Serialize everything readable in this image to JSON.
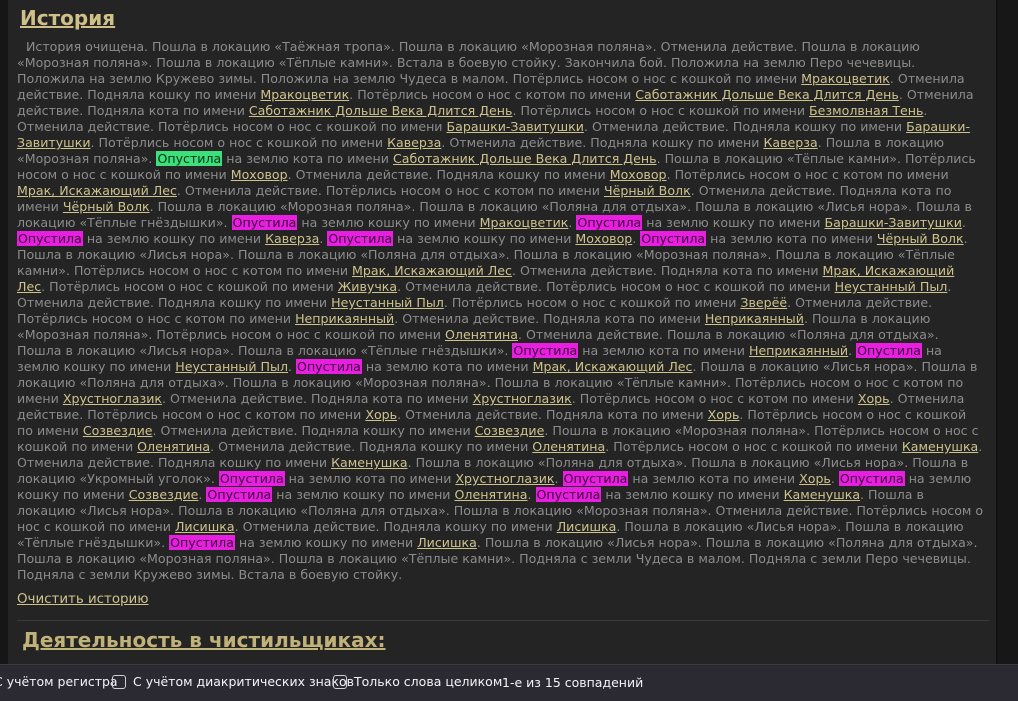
{
  "section_title": "История",
  "history_intro": "История очищена. Пошла в локацию «Таёжная тропа». Пошла в локацию «Морозная поляна». Отменила действие. Пошла в локацию «Морозная поляна». Пошла в локацию «Тёплые камни». Встала в боевую стойку. Закончила бой. Положила на землю Перо чечевицы. Положила на землю Кружево зимы. Положила на землю Чудеса в малом. Потёрлись носом о нос с кошкой по имени ",
  "history": [
    {
      "t": "text",
      "v": "История очищена. Пошла в локацию «Таёжная тропа». Пошла в локацию «Морозная поляна». Отменила действие. Пошла в локацию «Морозная поляна». Пошла в локацию «Тёплые камни». Встала в боевую стойку. Закончила бой. Положила на землю Перо чечевицы. Положила на землю Кружево зимы. Положила на землю Чудеса в малом. Потёрлись носом о нос с кошкой по имени "
    },
    {
      "t": "link",
      "v": "Мракоцветик"
    },
    {
      "t": "text",
      "v": ". Отменила действие. Подняла кошку по имени "
    },
    {
      "t": "link",
      "v": "Мракоцветик"
    },
    {
      "t": "text",
      "v": ". Потёрлись носом о нос с котом по имени "
    },
    {
      "t": "link",
      "v": "Саботажник Дольше Века Длится День"
    },
    {
      "t": "text",
      "v": ". Отменила действие. Подняла кота по имени "
    },
    {
      "t": "link",
      "v": "Саботажник Дольше Века Длится День"
    },
    {
      "t": "text",
      "v": ". Потёрлись носом о нос с кошкой по имени "
    },
    {
      "t": "link",
      "v": "Безмолвная Тень"
    },
    {
      "t": "text",
      "v": ". Отменила действие. Потёрлись носом о нос с кошкой по имени "
    },
    {
      "t": "link",
      "v": "Барашки-Завитушки"
    },
    {
      "t": "text",
      "v": ". Отменила действие. Подняла кошку по имени "
    },
    {
      "t": "link",
      "v": "Барашки-Завитушки"
    },
    {
      "t": "text",
      "v": ". Потёрлись носом о нос с кошкой по имени "
    },
    {
      "t": "link",
      "v": "Каверза"
    },
    {
      "t": "text",
      "v": ". Отменила действие. Подняла кошку по имени "
    },
    {
      "t": "link",
      "v": "Каверза"
    },
    {
      "t": "text",
      "v": ". Пошла в локацию «Морозная поляна». "
    },
    {
      "t": "cur",
      "v": "Опустила"
    },
    {
      "t": "text",
      "v": " на землю кота по имени "
    },
    {
      "t": "link",
      "v": "Саботажник Дольше Века Длится День"
    },
    {
      "t": "text",
      "v": ". Пошла в локацию «Тёплые камни». Потёрлись носом о нос с кошкой по имени "
    },
    {
      "t": "link",
      "v": "Моховор"
    },
    {
      "t": "text",
      "v": ". Отменила действие. Подняла кошку по имени "
    },
    {
      "t": "link",
      "v": "Моховор"
    },
    {
      "t": "text",
      "v": ". Потёрлись носом о нос с котом по имени "
    },
    {
      "t": "link",
      "v": "Мрак, Искажающий Лес"
    },
    {
      "t": "text",
      "v": ". Отменила действие. Потёрлись носом о нос с котом по имени "
    },
    {
      "t": "link",
      "v": "Чёрный Волк"
    },
    {
      "t": "text",
      "v": ". Отменила действие. Подняла кота по имени "
    },
    {
      "t": "link",
      "v": "Чёрный Волк"
    },
    {
      "t": "text",
      "v": ". Пошла в локацию «Морозная поляна». Пошла в локацию «Поляна для отдыха». Пошла в локацию «Лисья нора». Пошла в локацию «Тёплые гнёздышки». "
    },
    {
      "t": "hl",
      "v": "Опустила"
    },
    {
      "t": "text",
      "v": " на землю кошку по имени "
    },
    {
      "t": "link",
      "v": "Мракоцветик"
    },
    {
      "t": "text",
      "v": ". "
    },
    {
      "t": "hl",
      "v": "Опустила"
    },
    {
      "t": "text",
      "v": " на землю кошку по имени "
    },
    {
      "t": "link",
      "v": "Барашки-Завитушки"
    },
    {
      "t": "text",
      "v": ". "
    },
    {
      "t": "hl",
      "v": "Опустила"
    },
    {
      "t": "text",
      "v": " на землю кошку по имени "
    },
    {
      "t": "link",
      "v": "Каверза"
    },
    {
      "t": "text",
      "v": ". "
    },
    {
      "t": "hl",
      "v": "Опустила"
    },
    {
      "t": "text",
      "v": " на землю кошку по имени "
    },
    {
      "t": "link",
      "v": "Моховор"
    },
    {
      "t": "text",
      "v": ". "
    },
    {
      "t": "hl",
      "v": "Опустила"
    },
    {
      "t": "text",
      "v": " на землю кота по имени "
    },
    {
      "t": "link",
      "v": "Чёрный Волк"
    },
    {
      "t": "text",
      "v": ". Пошла в локацию «Лисья нора». Пошла в локацию «Поляна для отдыха». Пошла в локацию «Морозная поляна». Пошла в локацию «Тёплые камни». Потёрлись носом о нос с котом по имени "
    },
    {
      "t": "link",
      "v": "Мрак, Искажающий Лес"
    },
    {
      "t": "text",
      "v": ". Отменила действие. Подняла кота по имени "
    },
    {
      "t": "link",
      "v": "Мрак, Искажающий Лес"
    },
    {
      "t": "text",
      "v": ". Потёрлись носом о нос с кошкой по имени "
    },
    {
      "t": "link",
      "v": "Живучка"
    },
    {
      "t": "text",
      "v": ". Отменила действие. Потёрлись носом о нос с кошкой по имени "
    },
    {
      "t": "link",
      "v": "Неустанный Пыл"
    },
    {
      "t": "text",
      "v": ". Отменила действие. Подняла кошку по имени "
    },
    {
      "t": "link",
      "v": "Неустанный Пыл"
    },
    {
      "t": "text",
      "v": ". Потёрлись носом о нос с кошкой по имени "
    },
    {
      "t": "link",
      "v": "Зверёё"
    },
    {
      "t": "text",
      "v": ". Отменила действие. Потёрлись носом о нос с котом по имени "
    },
    {
      "t": "link",
      "v": "Неприкаянный"
    },
    {
      "t": "text",
      "v": ". Отменила действие. Подняла кота по имени "
    },
    {
      "t": "link",
      "v": "Неприкаянный"
    },
    {
      "t": "text",
      "v": ". Пошла в локацию «Морозная поляна». Потёрлись носом о нос с кошкой по имени "
    },
    {
      "t": "link",
      "v": "Оленятина"
    },
    {
      "t": "text",
      "v": ". Отменила действие. Пошла в локацию «Поляна для отдыха». Пошла в локацию «Лисья нора». Пошла в локацию «Тёплые гнёздышки». "
    },
    {
      "t": "hl",
      "v": "Опустила"
    },
    {
      "t": "text",
      "v": " на землю кота по имени "
    },
    {
      "t": "link",
      "v": "Неприкаянный"
    },
    {
      "t": "text",
      "v": ". "
    },
    {
      "t": "hl",
      "v": "Опустила"
    },
    {
      "t": "text",
      "v": " на землю кошку по имени "
    },
    {
      "t": "link",
      "v": "Неустанный Пыл"
    },
    {
      "t": "text",
      "v": ". "
    },
    {
      "t": "hl",
      "v": "Опустила"
    },
    {
      "t": "text",
      "v": " на землю кота по имени "
    },
    {
      "t": "link",
      "v": "Мрак, Искажающий Лес"
    },
    {
      "t": "text",
      "v": ". Пошла в локацию «Лисья нора». Пошла в локацию «Поляна для отдыха». Пошла в локацию «Морозная поляна». Пошла в локацию «Тёплые камни». Потёрлись носом о нос с котом по имени "
    },
    {
      "t": "link",
      "v": "Хрустноглазик"
    },
    {
      "t": "text",
      "v": ". Отменила действие. Подняла кота по имени "
    },
    {
      "t": "link",
      "v": "Хрустноглазик"
    },
    {
      "t": "text",
      "v": ". Потёрлись носом о нос с котом по имени "
    },
    {
      "t": "link",
      "v": "Хорь"
    },
    {
      "t": "text",
      "v": ". Отменила действие. Потёрлись носом о нос с котом по имени "
    },
    {
      "t": "link",
      "v": "Хорь"
    },
    {
      "t": "text",
      "v": ". Отменила действие. Подняла кота по имени "
    },
    {
      "t": "link",
      "v": "Хорь"
    },
    {
      "t": "text",
      "v": ". Потёрлись носом о нос с кошкой по имени "
    },
    {
      "t": "link",
      "v": "Созвездие"
    },
    {
      "t": "text",
      "v": ". Отменила действие. Подняла кошку по имени "
    },
    {
      "t": "link",
      "v": "Созвездие"
    },
    {
      "t": "text",
      "v": ". Пошла в локацию «Морозная поляна». Потёрлись носом о нос с кошкой по имени "
    },
    {
      "t": "link",
      "v": "Оленятина"
    },
    {
      "t": "text",
      "v": ". Отменила действие. Подняла кошку по имени "
    },
    {
      "t": "link",
      "v": "Оленятина"
    },
    {
      "t": "text",
      "v": ". Потёрлись носом о нос с кошкой по имени "
    },
    {
      "t": "link",
      "v": "Каменушка"
    },
    {
      "t": "text",
      "v": ". Отменила действие. Подняла кошку по имени "
    },
    {
      "t": "link",
      "v": "Каменушка"
    },
    {
      "t": "text",
      "v": ". Пошла в локацию «Поляна для отдыха». Пошла в локацию «Лисья нора». Пошла в локацию «Укромный уголок». "
    },
    {
      "t": "hl",
      "v": "Опустила"
    },
    {
      "t": "text",
      "v": " на землю кота по имени "
    },
    {
      "t": "link",
      "v": "Хрустноглазик"
    },
    {
      "t": "text",
      "v": ". "
    },
    {
      "t": "hl",
      "v": "Опустила"
    },
    {
      "t": "text",
      "v": " на землю кота по имени "
    },
    {
      "t": "link",
      "v": "Хорь"
    },
    {
      "t": "text",
      "v": ". "
    },
    {
      "t": "hl",
      "v": "Опустила"
    },
    {
      "t": "text",
      "v": " на землю кошку по имени "
    },
    {
      "t": "link",
      "v": "Созвездие"
    },
    {
      "t": "text",
      "v": ". "
    },
    {
      "t": "hl",
      "v": "Опустила"
    },
    {
      "t": "text",
      "v": " на землю кошку по имени "
    },
    {
      "t": "link",
      "v": "Оленятина"
    },
    {
      "t": "text",
      "v": ". "
    },
    {
      "t": "hl",
      "v": "Опустила"
    },
    {
      "t": "text",
      "v": " на землю кошку по имени "
    },
    {
      "t": "link",
      "v": "Каменушка"
    },
    {
      "t": "text",
      "v": ". Пошла в локацию «Лисья нора». Пошла в локацию «Поляна для отдыха». Пошла в локацию «Морозная поляна». Отменила действие. Потёрлись носом о нос с кошкой по имени "
    },
    {
      "t": "link",
      "v": "Лисишка"
    },
    {
      "t": "text",
      "v": ". Отменила действие. Подняла кошку по имени "
    },
    {
      "t": "link",
      "v": "Лисишка"
    },
    {
      "t": "text",
      "v": ". Пошла в локацию «Лисья нора». Пошла в локацию «Тёплые гнёздышки». "
    },
    {
      "t": "hl",
      "v": "Опустила"
    },
    {
      "t": "text",
      "v": " на землю кошку по имени "
    },
    {
      "t": "link",
      "v": "Лисишка"
    },
    {
      "t": "text",
      "v": ". Пошла в локацию «Лисья нора». Пошла в локацию «Поляна для отдыха». Пошла в локацию «Морозная поляна». Пошла в локацию «Тёплые камни». Подняла с земли Чудеса в малом. Подняла с земли Перо чечевицы. Подняла с земли Кружево зимы. Встала в боевую стойку."
    }
  ],
  "clear_history": "Очистить историю",
  "activity_title": "Деятельность в чистильщиках:",
  "findbar": {
    "match_case": "С учётом регистра",
    "match_diacritics": "С учётом диакритических знаков",
    "whole_words": "Только слова целиком",
    "count": "1-е из 15 совпадений"
  },
  "colors": {
    "background": "#242424",
    "link": "#cfc38c",
    "highlight": "#e81ee0",
    "current_highlight": "#3ee07b",
    "findbar": "#2b2a33"
  }
}
